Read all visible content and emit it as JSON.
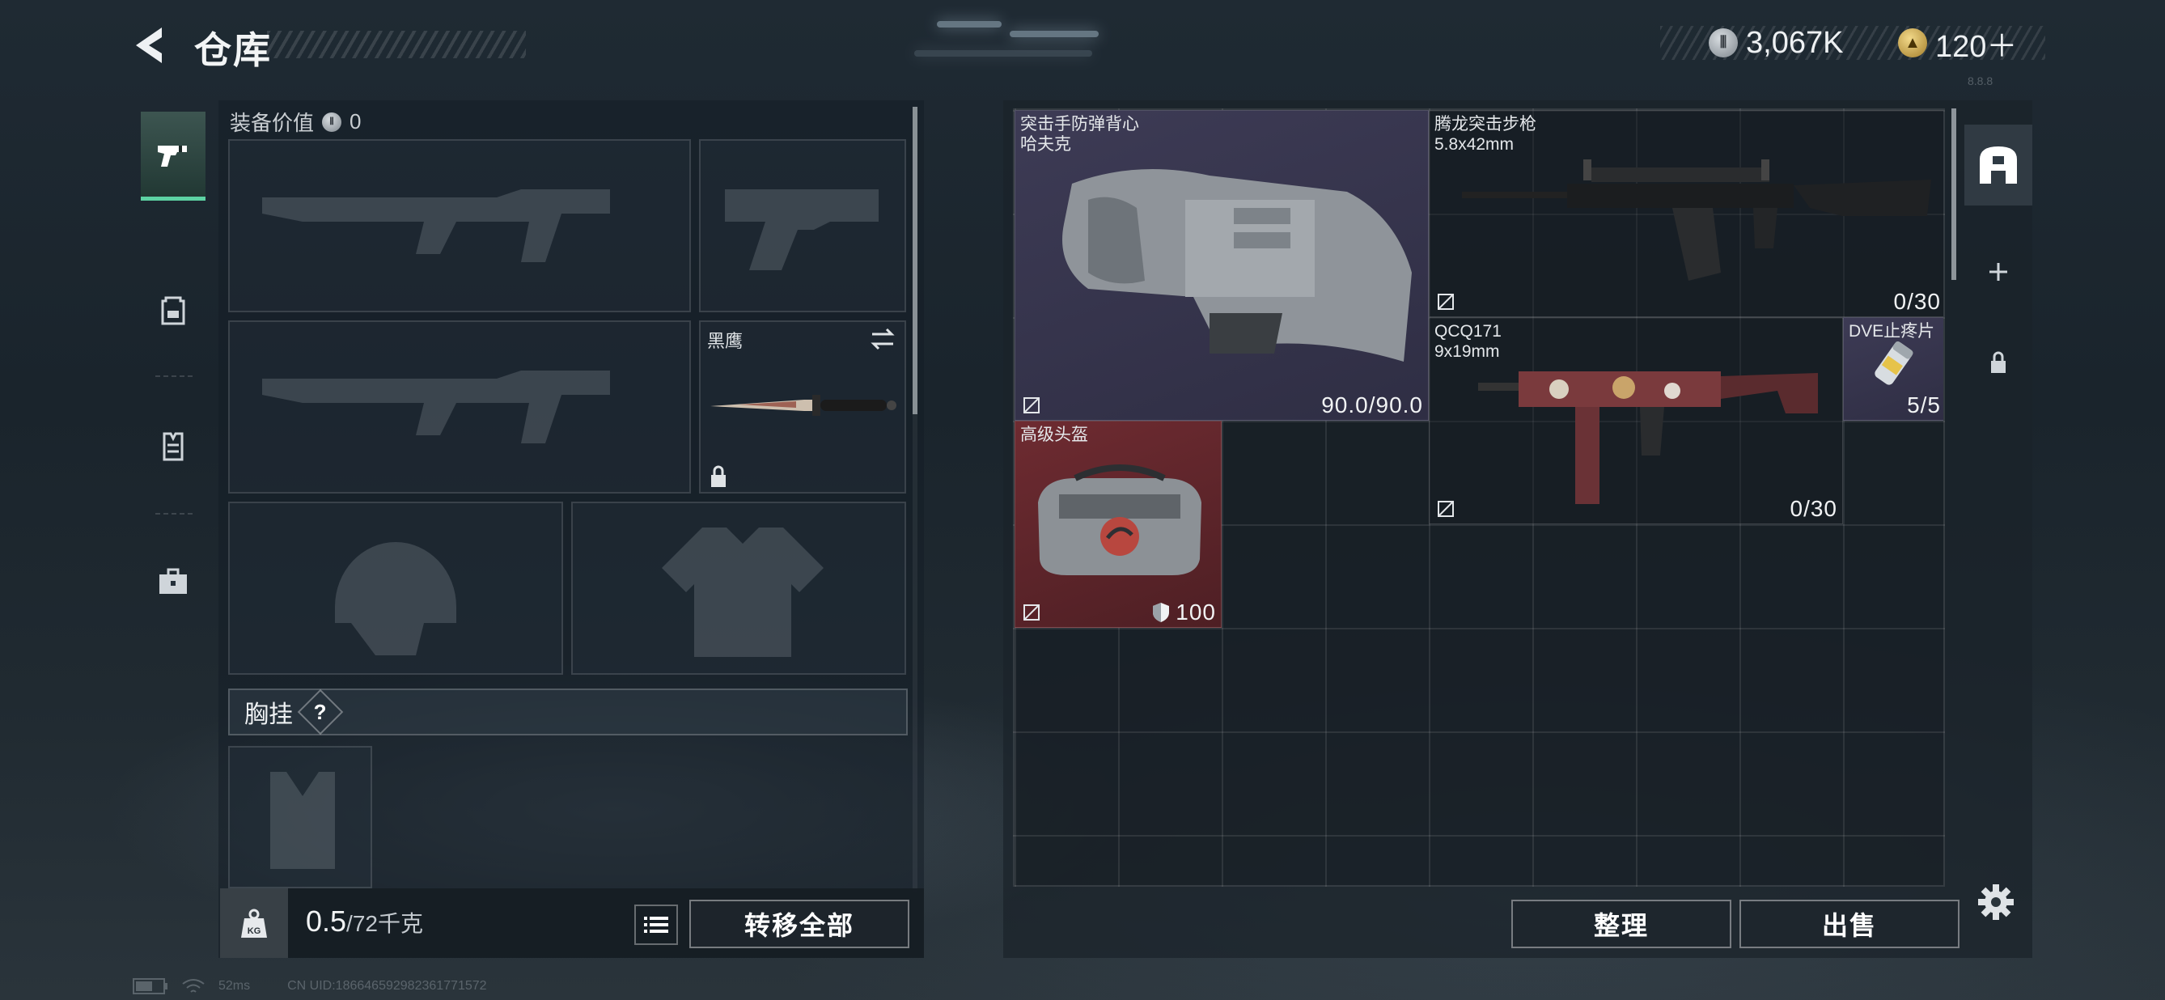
{
  "header": {
    "title": "仓库",
    "currency": {
      "silver_amount": "3,067K",
      "gold_amount": "120＋"
    },
    "status": {
      "ping": "52ms",
      "uid": "CN UID:18664659298236177157​2",
      "build": "8.8.8"
    }
  },
  "sidebar": {
    "tabs": [
      {
        "name": "weapons-tab",
        "icon": "pistol-icon",
        "active": true
      },
      {
        "name": "backpack-tab",
        "icon": "backpack-icon",
        "active": false
      },
      {
        "name": "chest-rig-tab",
        "icon": "vest-icon",
        "active": false
      },
      {
        "name": "kit-tab",
        "icon": "briefcase-icon",
        "active": false
      }
    ]
  },
  "loadout": {
    "equipment_value_label": "装备价值",
    "equipment_value": "0",
    "melee_slot_label": "黑鹰",
    "chest_rig_label": "胸挂",
    "help_mark": "?",
    "weight_current": "0.5",
    "weight_capacity": "/72千克",
    "weight_icon_text": "KG",
    "transfer_all_label": "转移全部"
  },
  "stash": {
    "items": [
      {
        "name_line1": "突击手防弹背心",
        "name_line2": "哈夫克",
        "count": "90.0/90.0"
      },
      {
        "name_line1": "腾龙突击步枪",
        "name_line2": "5.8x42mm",
        "count": "0/30"
      },
      {
        "name_line1": "QCQ171",
        "name_line2": "9x19mm",
        "count": "0/30"
      },
      {
        "name_line1": "DVE止疼片",
        "count": "5/5"
      },
      {
        "name_line1": "高级头盔",
        "count": "100"
      }
    ],
    "sort_label": "整理",
    "sell_label": "出售"
  },
  "right_tabs": [
    {
      "icon": "stash-icon",
      "active": true
    },
    {
      "icon": "plus-icon",
      "active": false
    },
    {
      "icon": "lock-icon",
      "active": false
    }
  ],
  "colors": {
    "accent": "#5dd2a3",
    "rare_red": "#6a2a2e",
    "epic_purple": "#3c3a55"
  }
}
